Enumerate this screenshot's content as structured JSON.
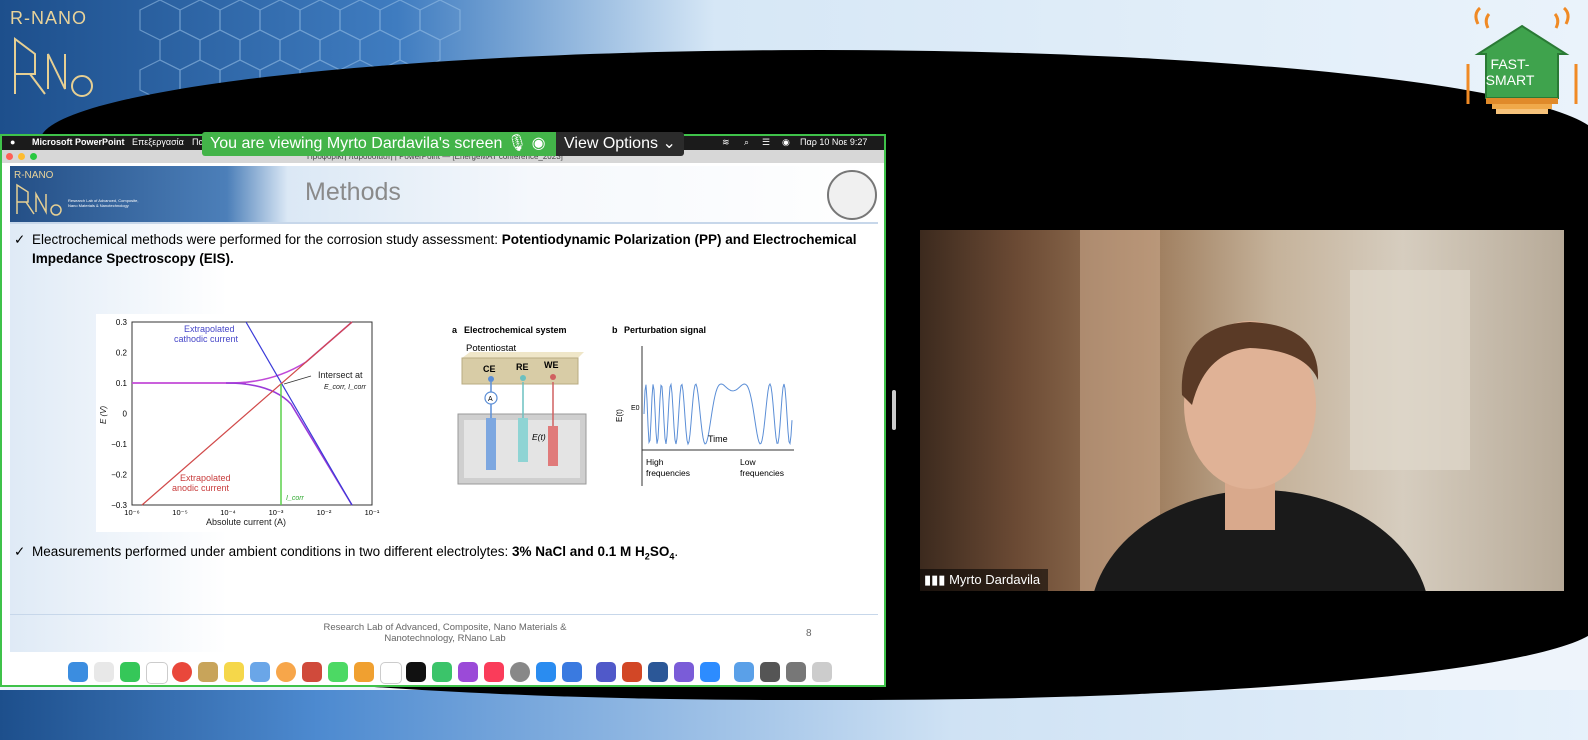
{
  "background": {
    "brand": "R-NANO",
    "badge_line1": "FAST-",
    "badge_line2": "SMART"
  },
  "share_banner": {
    "viewing_text": "You are viewing Myrto Dardavila's screen",
    "view_options": "View Options"
  },
  "mac_menubar": {
    "app": "Microsoft PowerPoint",
    "menu1": "Επεξεργασία",
    "menu2": "Πα",
    "clock": "Παρ 10 Νοε 9:27 π.μ."
  },
  "window_title": "Προφορική παρουσίαση | PowerPoint — [EnergeMAT conference_2023]",
  "slide": {
    "brand": "R-NANO",
    "brand_sub": "Research Lab of Advanced, Composite, Nano Materials & Nanotechnology",
    "title": "Methods",
    "bullet1_a": "Electrochemical methods were performed for the corrosion study assessment: ",
    "bullet1_b": "Potentiodynamic Polarization (PP) and Electrochemical Impedance Spectroscopy (EIS).",
    "bullet2_a": "Measurements performed under ambient conditions in two different electrolytes: ",
    "bullet2_b": "3% NaCl and 0.1 M H",
    "bullet2_sub1": "2",
    "bullet2_c": "SO",
    "bullet2_sub2": "4",
    "bullet2_d": ".",
    "footer_line1": "Research Lab of Advanced, Composite, Nano Materials &",
    "footer_line2": "Nanotechnology, RNano Lab",
    "page_number": "8",
    "tafel": {
      "label_cathodic1": "Extrapolated",
      "label_cathodic2": "cathodic current",
      "label_anodic1": "Extrapolated",
      "label_anodic2": "anodic current",
      "label_intersect": "Intersect at",
      "label_intersect2": "E_corr, I_corr",
      "ylabel": "E (V)",
      "xlabel": "Absolute current (A)",
      "yticks": [
        "0.3",
        "0.2",
        "0.1",
        "0",
        "−0.1",
        "−0.2",
        "−0.3"
      ],
      "xticks": [
        "10⁻⁶",
        "10⁻⁵",
        "10⁻⁴",
        "10⁻³",
        "10⁻²",
        "10⁻¹"
      ],
      "icorr": "I_corr"
    },
    "eis": {
      "a_label": "a",
      "a_title": "Electrochemical system",
      "potentiostat": "Potentiostat",
      "ce": "CE",
      "re": "RE",
      "we": "WE",
      "ammeter": "A",
      "et": "E(t)",
      "b_label": "b",
      "b_title": "Perturbation signal",
      "ylabel": "E(t)",
      "e0": "E0",
      "time": "Time",
      "high1": "High",
      "high2": "frequencies",
      "low1": "Low",
      "low2": "frequencies"
    }
  },
  "participant": {
    "name": "Myrto Dardavila"
  },
  "colors": {
    "share_border": "#3fc24a",
    "banner_green": "#43b449"
  }
}
